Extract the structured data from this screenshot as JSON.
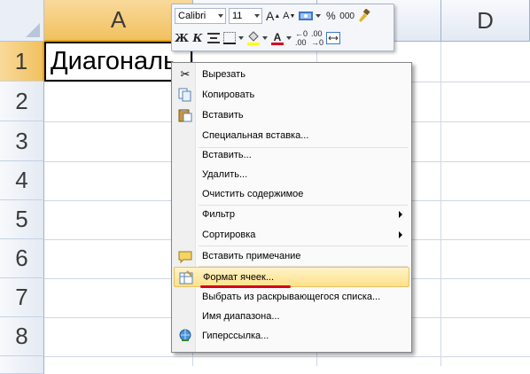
{
  "sheet": {
    "columns": [
      {
        "label": "A"
      },
      {
        "label": ""
      },
      {
        "label": ""
      },
      {
        "label": "D"
      }
    ],
    "rows": [
      "1",
      "2",
      "3",
      "4",
      "5",
      "6",
      "7",
      "8",
      ""
    ],
    "cell_a1": "Диагональ"
  },
  "mini_toolbar": {
    "font_name": "Calibri",
    "font_size": "11",
    "percent": "%",
    "thousands": "000",
    "bold": "Ж",
    "italic": "К",
    "font_color_letter": "A",
    "accent_red": "#d8001c"
  },
  "context_menu": {
    "items": [
      {
        "label": "Вырезать",
        "icon": "scissors-icon"
      },
      {
        "label": "Копировать",
        "icon": "copy-icon"
      },
      {
        "label": "Вставить",
        "icon": "paste-icon"
      },
      {
        "label": "Специальная вставка...",
        "icon": ""
      },
      {
        "label": "Вставить...",
        "icon": ""
      },
      {
        "label": "Удалить...",
        "icon": ""
      },
      {
        "label": "Очистить содержимое",
        "icon": ""
      },
      {
        "label": "Фильтр",
        "icon": "",
        "submenu": true
      },
      {
        "label": "Сортировка",
        "icon": "",
        "submenu": true
      },
      {
        "label": "Вставить примечание",
        "icon": "comment-icon"
      },
      {
        "label": "Формат ячеек...",
        "icon": "format-cells-icon",
        "highlighted": true
      },
      {
        "label": "Выбрать из раскрывающегося списка...",
        "icon": ""
      },
      {
        "label": "Имя диапазона...",
        "icon": ""
      },
      {
        "label": "Гиперссылка...",
        "icon": "hyperlink-icon"
      }
    ]
  }
}
